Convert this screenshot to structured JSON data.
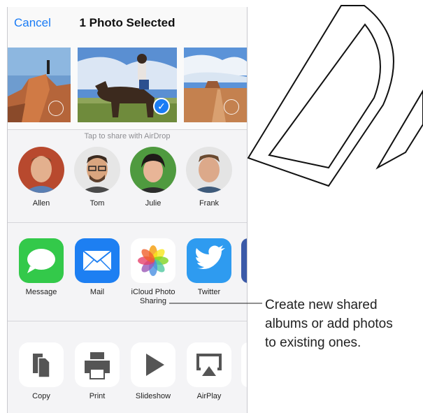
{
  "navbar": {
    "cancel_label": "Cancel",
    "title": "1 Photo Selected"
  },
  "photos": [
    {
      "description": "canyon-photo",
      "selected": false
    },
    {
      "description": "horse-rider-photo",
      "selected": true
    },
    {
      "description": "desert-mesa-photo",
      "selected": false
    }
  ],
  "airdrop": {
    "hint": "Tap to share with AirDrop",
    "contacts": [
      {
        "name": "Allen"
      },
      {
        "name": "Tom"
      },
      {
        "name": "Julie"
      },
      {
        "name": "Frank"
      }
    ]
  },
  "share_apps": [
    {
      "label": "Message",
      "icon": "message-icon"
    },
    {
      "label": "Mail",
      "icon": "mail-icon"
    },
    {
      "label": "iCloud Photo Sharing",
      "icon": "photos-icon"
    },
    {
      "label": "Twitter",
      "icon": "twitter-icon"
    }
  ],
  "actions": [
    {
      "label": "Copy",
      "icon": "copy-icon"
    },
    {
      "label": "Print",
      "icon": "print-icon"
    },
    {
      "label": "Slideshow",
      "icon": "slideshow-icon"
    },
    {
      "label": "AirPlay",
      "icon": "airplay-icon"
    }
  ],
  "callout": {
    "line1": "Create new shared",
    "line2": "albums or add photos",
    "line3": "to existing ones."
  },
  "colors": {
    "accent": "#1a7cf5",
    "watermark": "#000000"
  }
}
